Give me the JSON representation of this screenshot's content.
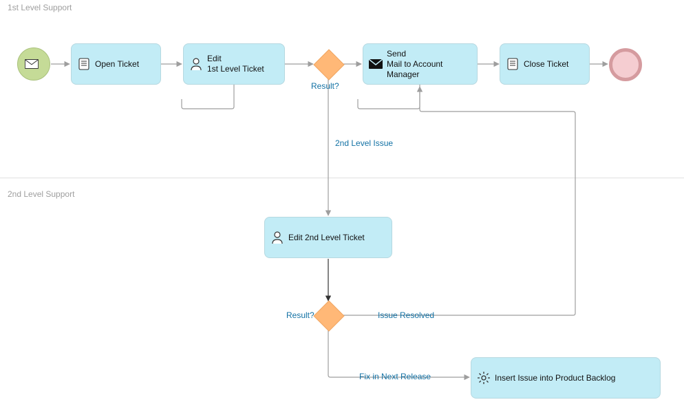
{
  "lanes": {
    "lane1_label": "1st Level Support",
    "lane2_label": "2nd Level Support"
  },
  "tasks": {
    "open_ticket": {
      "label": "Open Ticket"
    },
    "edit_l1": {
      "label": "Edit\n1st Level Ticket"
    },
    "send_mail": {
      "label": "Send\nMail to Account\nManager"
    },
    "close_ticket": {
      "label": "Close Ticket"
    },
    "edit_l2": {
      "label": "Edit 2nd Level Ticket"
    },
    "insert_backlog": {
      "label": "Insert Issue into Product Backlog"
    }
  },
  "gateways": {
    "g1": {
      "label": "Result?"
    },
    "g2": {
      "label": "Result?"
    }
  },
  "flows": {
    "l2_issue": "2nd Level Issue",
    "issue_resolved": "Issue Resolved",
    "fix_next": "Fix in Next Release"
  },
  "icons": {
    "envelope": "envelope",
    "script": "script",
    "user": "user",
    "mail_filled": "mail-filled",
    "gear": "gear"
  }
}
